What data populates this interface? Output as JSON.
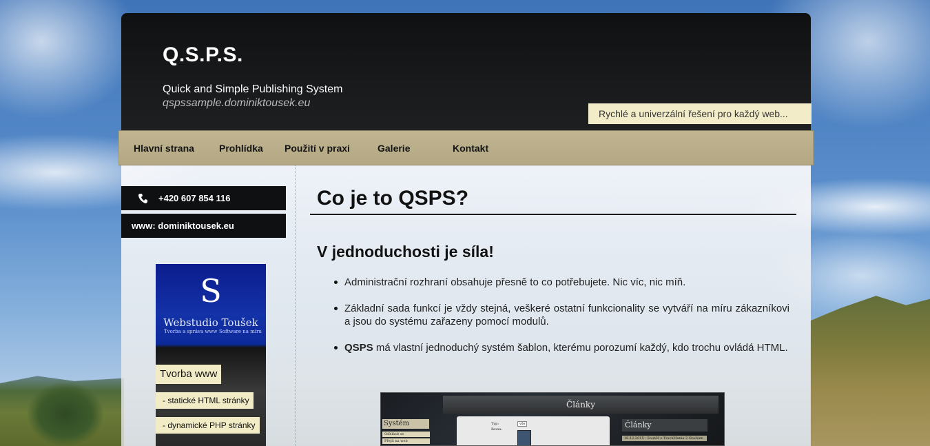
{
  "header": {
    "title": "Q.S.P.S.",
    "subtitle": "Quick and Simple Publishing System",
    "domain": "qspssample.dominiktousek.eu",
    "slogan": "Rychlé a univerzální řešení pro každý web..."
  },
  "nav": {
    "items": [
      {
        "label": "Hlavní strana"
      },
      {
        "label": "Prohlídka"
      },
      {
        "label": "Použití v praxi"
      },
      {
        "label": "Galerie"
      },
      {
        "label": "Kontakt"
      }
    ]
  },
  "sidebar": {
    "phone_icon": "phone-icon",
    "phone": "+420 607 854 116",
    "www": "www: dominiktousek.eu",
    "banner": {
      "logo_glyph": "S",
      "name": "Webstudio Toušek",
      "tagline_left": "Tvorba a správa www",
      "tagline_right": "Software na míru",
      "heading": "Tvorba www",
      "items": [
        "- statické HTML stránky",
        "- dynamické PHP stránky"
      ]
    }
  },
  "main": {
    "title": "Co je to QSPS?",
    "section_title": "V jednoduchosti je síla!",
    "bullets": [
      {
        "text": "Administrační rozhraní obsahuje přesně to co potřebujete. Nic víc, nic míň."
      },
      {
        "text": "Základní sada funkcí je vždy stejná, veškeré ostatní funkcionality se vytváří na míru zákazníkovi a jsou do systému zařazeny pomocí modulů."
      },
      {
        "bold": "QSPS",
        "text": " má vlastní jednoduchý systém šablon, kterému porozumí každý, kdo trochu ovládá HTML."
      }
    ],
    "screenshot": {
      "title": "Články",
      "left_title": "Systém",
      "left_items": [
        "Odhlásit se",
        "Přejít na web"
      ],
      "center_labels": [
        "Typ:",
        "Ikona:"
      ],
      "center_select": "vše",
      "right_title": "Články",
      "right_item": "16.12.2015 - Soutěž o TrackMania 2 Stadium"
    }
  }
}
